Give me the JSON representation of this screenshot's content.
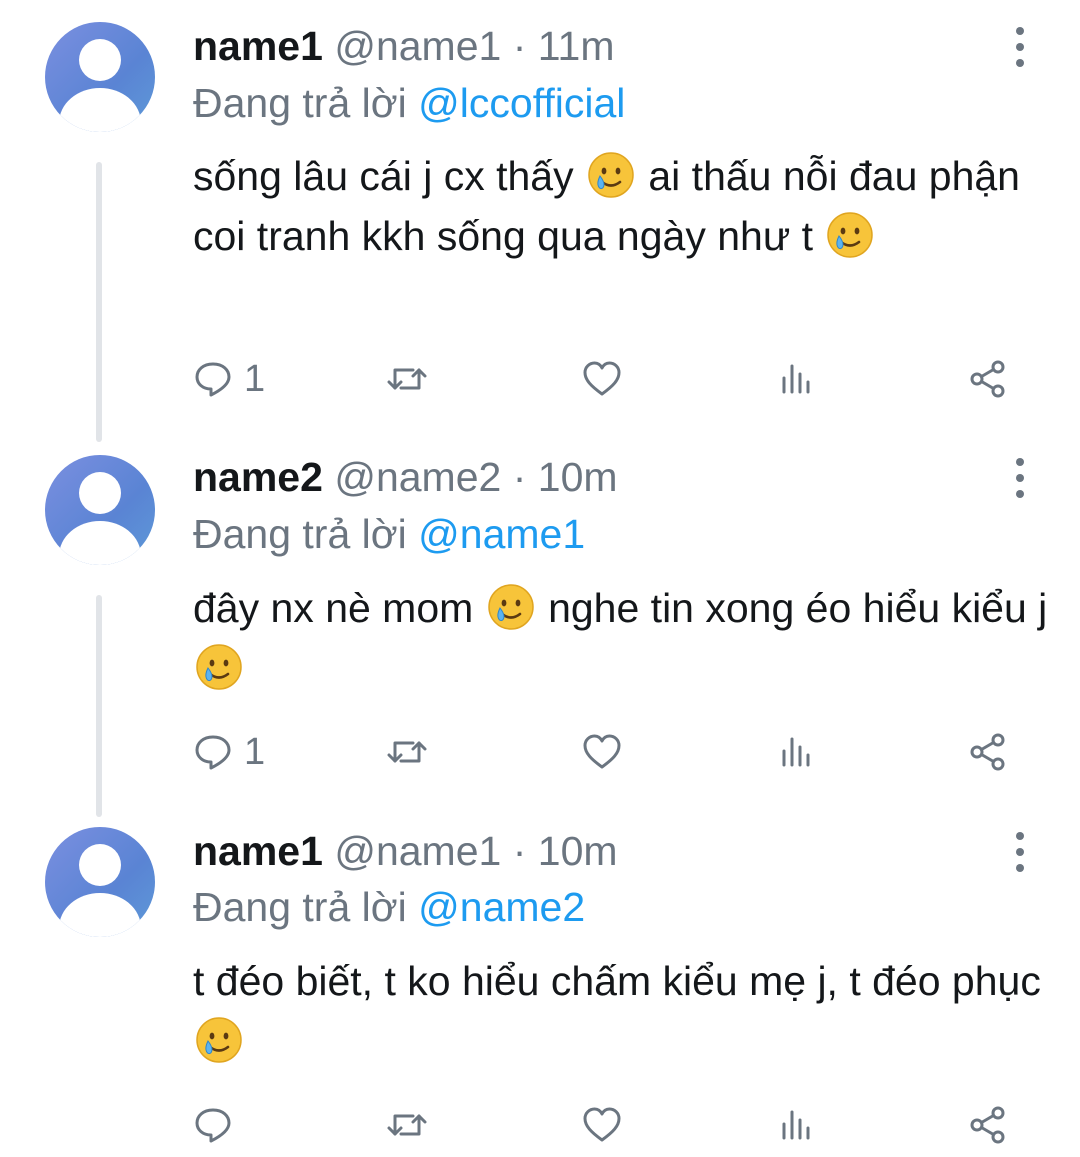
{
  "tweets": [
    {
      "name": "name1",
      "handle": "@name1",
      "separator": "·",
      "time": "11m",
      "replying_label": "Đang trả lời",
      "replying_to": "@lccofficial",
      "content": [
        {
          "type": "text",
          "value": "sống lâu cái j cx thấy "
        },
        {
          "type": "emoji",
          "value": "smiling-face-with-tear"
        },
        {
          "type": "text",
          "value": " ai thấu nỗi đau phận coi tranh kkh sống qua ngày như t "
        },
        {
          "type": "emoji",
          "value": "smiling-face-with-tear"
        }
      ],
      "reply_count": "1",
      "retweet_count": "",
      "like_count": ""
    },
    {
      "name": "name2",
      "handle": "@name2",
      "separator": "·",
      "time": "10m",
      "replying_label": "Đang trả lời",
      "replying_to": "@name1",
      "content": [
        {
          "type": "text",
          "value": "đây nx nè mom "
        },
        {
          "type": "emoji",
          "value": "smiling-face-with-tear"
        },
        {
          "type": "text",
          "value": " nghe tin xong éo hiểu kiểu j "
        },
        {
          "type": "emoji",
          "value": "smiling-face-with-tear"
        }
      ],
      "reply_count": "1",
      "retweet_count": "",
      "like_count": ""
    },
    {
      "name": "name1",
      "handle": "@name1",
      "separator": "·",
      "time": "10m",
      "replying_label": "Đang trả lời",
      "replying_to": "@name2",
      "content": [
        {
          "type": "text",
          "value": "t đéo biết, t ko hiểu chấm kiểu mẹ j, t đéo phục "
        },
        {
          "type": "emoji",
          "value": "smiling-face-with-tear"
        }
      ],
      "reply_count": "",
      "retweet_count": "",
      "like_count": ""
    }
  ],
  "icons": {
    "reply": "reply-icon",
    "retweet": "retweet-icon",
    "like": "heart-icon",
    "analytics": "analytics-icon",
    "share": "share-icon",
    "more": "more-vertical-icon",
    "avatar": "default-avatar-icon"
  },
  "colors": {
    "mention": "#1d9bf0",
    "muted": "#6b7580",
    "text": "#14171a",
    "avatar": "#5a84d4",
    "thread_line": "#e1e4e8"
  }
}
